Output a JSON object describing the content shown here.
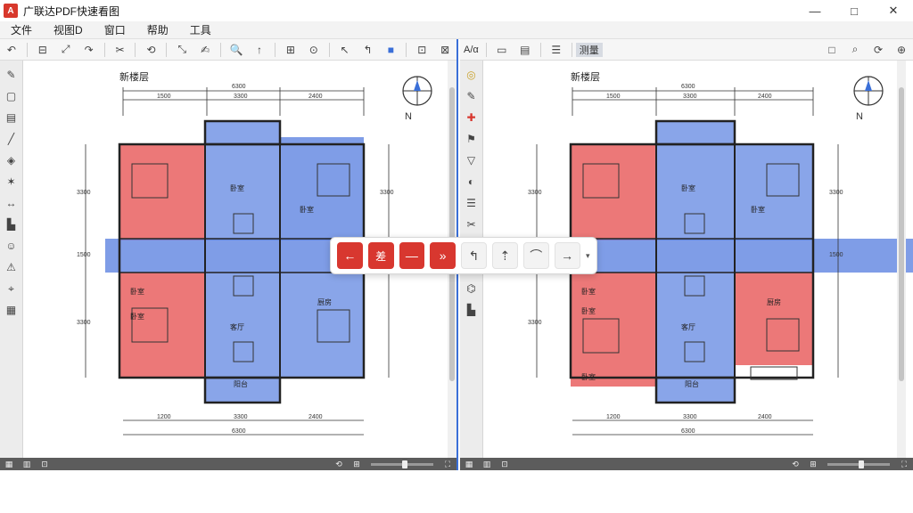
{
  "window": {
    "title": "广联达PDF快速看图",
    "logo": "A",
    "controls": [
      "—",
      "□",
      "✕"
    ]
  },
  "menu": {
    "items": [
      "文件",
      "视图D",
      "窗口",
      "帮助",
      "工具"
    ]
  },
  "toolbar_left": {
    "items": [
      "↶",
      "⊟",
      "⤢",
      "↷",
      "✂",
      "⟲",
      "⤡",
      "✍",
      "🔍",
      "↑",
      "⊞",
      "⊙",
      "↖",
      "↰",
      "■",
      "⊡",
      "⊠"
    ]
  },
  "toolbar_right": {
    "items": [
      "A/α",
      "▭",
      "▤",
      "☰",
      "□",
      "⌕",
      "⟳",
      "⊕"
    ],
    "active_label": "测量"
  },
  "sidebar_left": {
    "items": [
      "✎",
      "▢",
      "▤",
      "╱",
      "◈",
      "✶",
      "↔",
      "▙",
      "☺",
      "⚠",
      "⌖",
      "▦"
    ]
  },
  "sidebar_right": {
    "items": [
      "◎",
      "✎",
      "✚",
      "⚑",
      "▽",
      "◐",
      "☰",
      "✂",
      "▦",
      "✶",
      "⌬",
      "▙"
    ]
  },
  "drawing_left": {
    "title": "新楼层",
    "dim_top_total": "6300",
    "dim_top_1": "1500",
    "dim_top_2": "3300",
    "dim_top_3": "2400",
    "dim_bottom_1": "1200",
    "dim_bottom_2": "3300",
    "dim_bottom_3": "2400",
    "dim_bottom_total": "6300",
    "dim_left_1": "3300",
    "dim_left_2": "1500",
    "dim_left_3": "3300",
    "dim_right_1": "3300",
    "dim_right_2": "1500",
    "room_1": "卧室",
    "room_2": "卧室",
    "room_3": "卧室",
    "room_4": "客厅",
    "room_5": "厨房",
    "room_6": "卧室",
    "room_7": "阳台",
    "north_label": "N"
  },
  "drawing_right": {
    "title": "新楼层",
    "dim_top_total": "6300",
    "dim_top_1": "1500",
    "dim_top_2": "3300",
    "dim_top_3": "2400",
    "dim_bottom_1": "1200",
    "dim_bottom_2": "3300",
    "dim_bottom_3": "2400",
    "dim_bottom_total": "6300",
    "dim_left_1": "3300",
    "dim_left_2": "1500",
    "dim_left_3": "3300",
    "dim_right_1": "3300",
    "dim_right_2": "1500",
    "room_1": "卧室",
    "room_2": "卧室",
    "room_3": "卧室",
    "room_4": "客厅",
    "room_5": "厨房",
    "room_6": "卧室",
    "room_7": "阳台",
    "room_8": "卧室",
    "north_label": "N"
  },
  "compare_bar": {
    "prev": "←",
    "center": "差",
    "minus": "—",
    "next": "»",
    "tool_1": "↰",
    "tool_2": "⇡",
    "tool_3": "⌒",
    "tool_4": "→",
    "more": "▾"
  },
  "statusbar": {
    "left_icons": [
      "▦",
      "▥",
      "⊡"
    ],
    "right_icons": [
      "⟲",
      "⊞",
      "⛶"
    ],
    "zoom_level": 0.55
  },
  "colors": {
    "highlight_red": "#e85a5a",
    "highlight_blue": "#5b82e0",
    "accent": "#d8372f",
    "divider": "#3a6fd8"
  }
}
